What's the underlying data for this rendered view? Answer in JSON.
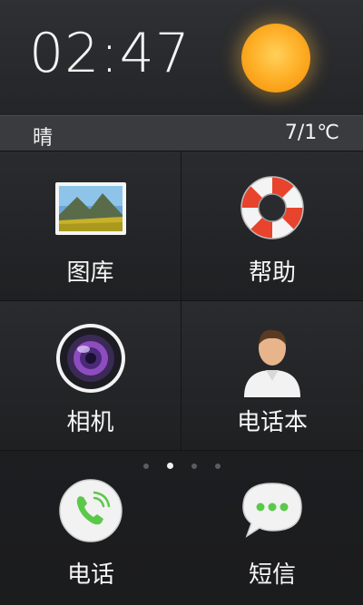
{
  "header": {
    "time": "02:47",
    "weather_icon": "sun-icon",
    "condition": "晴",
    "temperature": "7/1℃"
  },
  "grid": [
    {
      "label": "图库",
      "icon": "gallery-icon"
    },
    {
      "label": "帮助",
      "icon": "lifebuoy-icon"
    },
    {
      "label": "相机",
      "icon": "camera-icon"
    },
    {
      "label": "电话本",
      "icon": "contacts-icon"
    }
  ],
  "pager": {
    "pages": 4,
    "active": 2
  },
  "dock": [
    {
      "label": "电话",
      "icon": "phone-icon"
    },
    {
      "label": "短信",
      "icon": "message-icon"
    }
  ],
  "colors": {
    "accent_green": "#5cc84a",
    "sun": "#ffb12a",
    "lifebuoy_red": "#e8432c"
  }
}
